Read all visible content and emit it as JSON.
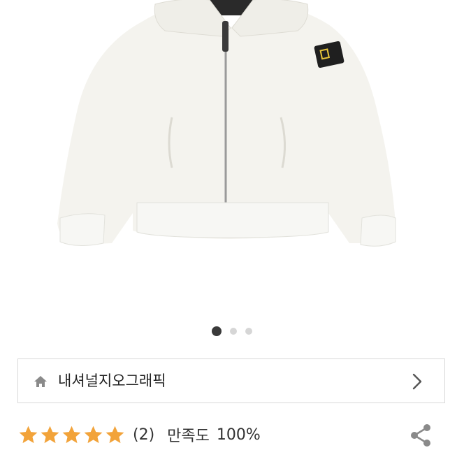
{
  "product_image": {
    "description_icon": "jacket-image",
    "badge_text": ""
  },
  "gallery": {
    "total_pages": 3,
    "current_page": 1
  },
  "store": {
    "icon": "home-icon",
    "name": "내셔널지오그래픽",
    "chevron_icon": "chevron-right-icon"
  },
  "rating": {
    "stars": 5,
    "star_color": "#f2a33a",
    "count": "(2)",
    "satisfaction_label": "만족도",
    "satisfaction_value": "100%"
  },
  "share": {
    "icon": "share-icon"
  }
}
